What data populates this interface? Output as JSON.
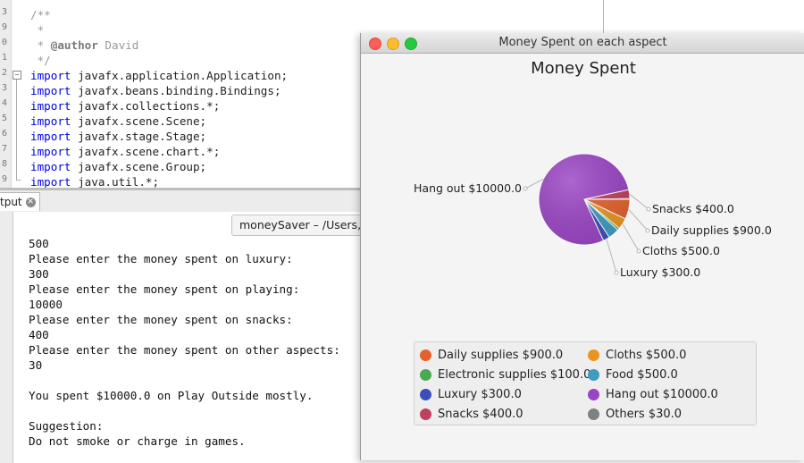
{
  "editor": {
    "gutter_numbers": [
      "3",
      "9",
      "0",
      "1",
      "2",
      "3",
      "4",
      "5",
      "6",
      "7",
      "8",
      "9"
    ],
    "lines": [
      [
        {
          "t": "/**",
          "c": "comment"
        }
      ],
      [
        {
          "t": " *",
          "c": "comment"
        }
      ],
      [
        {
          "t": " * ",
          "c": "comment"
        },
        {
          "t": "@author",
          "c": "tag"
        },
        {
          "t": " David",
          "c": "comment"
        }
      ],
      [
        {
          "t": " */",
          "c": "comment"
        }
      ],
      [
        {
          "t": "import",
          "c": "kw"
        },
        {
          "t": " javafx.application.Application;",
          "c": "plain"
        }
      ],
      [
        {
          "t": "import",
          "c": "kw"
        },
        {
          "t": " javafx.beans.binding.Bindings;",
          "c": "plain"
        }
      ],
      [
        {
          "t": "import",
          "c": "kw"
        },
        {
          "t": " javafx.collections.*;",
          "c": "plain"
        }
      ],
      [
        {
          "t": "import",
          "c": "kw"
        },
        {
          "t": " javafx.scene.Scene;",
          "c": "plain"
        }
      ],
      [
        {
          "t": "import",
          "c": "kw"
        },
        {
          "t": " javafx.stage.Stage;",
          "c": "plain"
        }
      ],
      [
        {
          "t": "import",
          "c": "kw"
        },
        {
          "t": " javafx.scene.chart.*;",
          "c": "plain"
        }
      ],
      [
        {
          "t": "import",
          "c": "kw"
        },
        {
          "t": " javafx.scene.Group;",
          "c": "plain"
        }
      ],
      [
        {
          "t": "import",
          "c": "kw"
        },
        {
          "t": " java.util.*;",
          "c": "plain"
        }
      ]
    ]
  },
  "output": {
    "tab_label": "tput",
    "session_tab": "moneySaver – /Users,",
    "lines": [
      "500",
      "Please enter the money spent on luxury:",
      "300",
      "Please enter the money spent on playing:",
      "10000",
      "Please enter the money spent on snacks:",
      "400",
      "Please enter the money spent on other aspects:",
      "30",
      "",
      "You spent $10000.0 on Play Outside mostly.",
      "",
      "Suggestion:",
      "Do not smoke or charge in games."
    ]
  },
  "chart_window": {
    "title": "Money Spent on each aspect"
  },
  "chart_data": {
    "type": "pie",
    "title": "Money Spent",
    "slices": [
      {
        "name": "Daily supplies",
        "value": 900.0,
        "label": "Daily supplies $900.0",
        "legend": "Daily supplies $900.0",
        "color": "#e2622f"
      },
      {
        "name": "Cloths",
        "value": 500.0,
        "label": "Cloths $500.0",
        "legend": "Cloths $500.0",
        "color": "#e9951f"
      },
      {
        "name": "Electronic supplies",
        "value": 100.0,
        "label": "",
        "legend": "Electronic supplies $100.0",
        "color": "#4aaa52"
      },
      {
        "name": "Food",
        "value": 500.0,
        "label": "",
        "legend": "Food $500.0",
        "color": "#3f9bbf"
      },
      {
        "name": "Luxury",
        "value": 300.0,
        "label": "Luxury $300.0",
        "legend": "Luxury $300.0",
        "color": "#3c4fb8"
      },
      {
        "name": "Hang out",
        "value": 10000.0,
        "label": "Hang out $10000.0",
        "legend": "Hang out $10000.0",
        "color": "#9a45c4"
      },
      {
        "name": "Snacks",
        "value": 400.0,
        "label": "Snacks $400.0",
        "legend": "Snacks $400.0",
        "color": "#c0405e"
      },
      {
        "name": "Others",
        "value": 30.0,
        "label": "",
        "legend": "Others $30.0",
        "color": "#808080"
      }
    ],
    "legend_placement": "bottom"
  }
}
